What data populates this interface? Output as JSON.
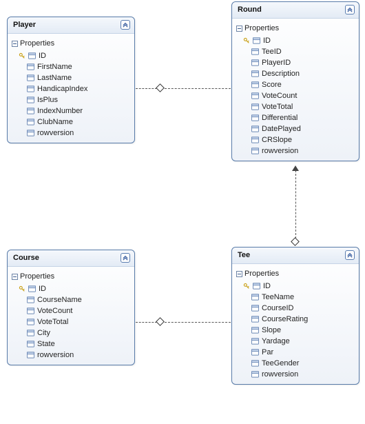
{
  "entities": {
    "player": {
      "title": "Player",
      "group_label": "Properties",
      "keys": [
        "ID"
      ],
      "fields": [
        "FirstName",
        "LastName",
        "HandicapIndex",
        "IsPlus",
        "IndexNumber",
        "ClubName",
        "rowversion"
      ]
    },
    "round": {
      "title": "Round",
      "group_label": "Properties",
      "keys": [
        "ID"
      ],
      "fields": [
        "TeeID",
        "PlayerID",
        "Description",
        "Score",
        "VoteCount",
        "VoteTotal",
        "Differential",
        "DatePlayed",
        "CRSlope",
        "rowversion"
      ]
    },
    "course": {
      "title": "Course",
      "group_label": "Properties",
      "keys": [
        "ID"
      ],
      "fields": [
        "CourseName",
        "VoteCount",
        "VoteTotal",
        "City",
        "State",
        "rowversion"
      ]
    },
    "tee": {
      "title": "Tee",
      "group_label": "Properties",
      "keys": [
        "ID"
      ],
      "fields": [
        "TeeName",
        "CourseID",
        "CourseRating",
        "Slope",
        "Yardage",
        "Par",
        "TeeGender",
        "rowversion"
      ]
    }
  },
  "relationships": [
    {
      "from": "player",
      "to": "round",
      "type": "association"
    },
    {
      "from": "course",
      "to": "tee",
      "type": "association"
    },
    {
      "from": "tee",
      "to": "round",
      "type": "association"
    }
  ],
  "colors": {
    "border": "#577aa8",
    "header_grad_from": "#f5f8fc",
    "header_grad_to": "#e3ebf5"
  },
  "chart_data": {
    "type": "diagram",
    "note": "Entity-relationship class diagram",
    "nodes": [
      {
        "name": "Player",
        "key": "ID",
        "attrs": [
          "FirstName",
          "LastName",
          "HandicapIndex",
          "IsPlus",
          "IndexNumber",
          "ClubName",
          "rowversion"
        ]
      },
      {
        "name": "Round",
        "key": "ID",
        "attrs": [
          "TeeID",
          "PlayerID",
          "Description",
          "Score",
          "VoteCount",
          "VoteTotal",
          "Differential",
          "DatePlayed",
          "CRSlope",
          "rowversion"
        ]
      },
      {
        "name": "Course",
        "key": "ID",
        "attrs": [
          "CourseName",
          "VoteCount",
          "VoteTotal",
          "City",
          "State",
          "rowversion"
        ]
      },
      {
        "name": "Tee",
        "key": "ID",
        "attrs": [
          "TeeName",
          "CourseID",
          "CourseRating",
          "Slope",
          "Yardage",
          "Par",
          "TeeGender",
          "rowversion"
        ]
      }
    ],
    "edges": [
      {
        "from": "Player",
        "to": "Round"
      },
      {
        "from": "Course",
        "to": "Tee"
      },
      {
        "from": "Tee",
        "to": "Round"
      }
    ]
  }
}
